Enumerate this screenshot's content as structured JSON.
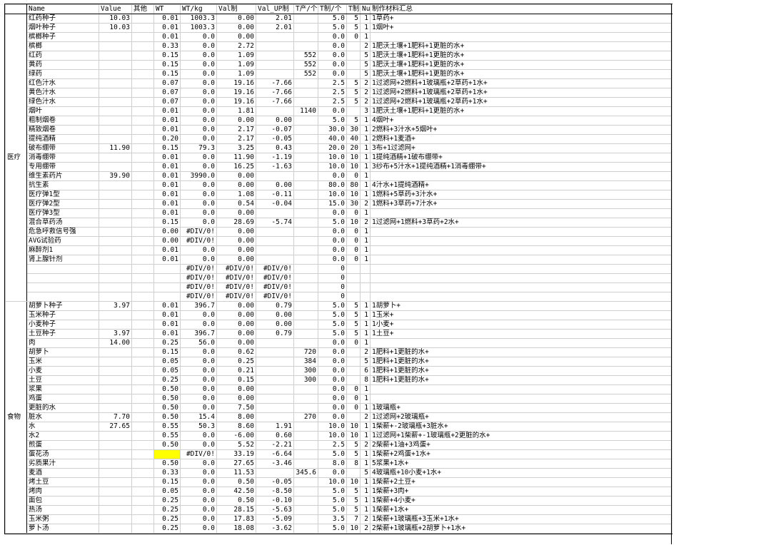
{
  "headers": [
    "",
    "Name",
    "Value",
    "其他",
    "WT",
    "WT/kg",
    "Val制",
    "Val_UP制",
    "T产/个",
    "T制/个",
    "T制",
    "Num",
    "制作材料汇总"
  ],
  "groups": [
    {
      "label": "医疗",
      "rows": [
        [
          "红药种子",
          "10.03",
          "",
          "0.01",
          "1003.3",
          "0.00",
          "2.01",
          "",
          "5.0",
          "5",
          "1",
          "1草药+"
        ],
        [
          "烟叶种子",
          "10.03",
          "",
          "0.01",
          "1003.3",
          "0.00",
          "2.01",
          "",
          "5.0",
          "5",
          "1",
          "1烟叶+"
        ],
        [
          "槟榔种子",
          "",
          "",
          "0.01",
          "0.0",
          "0.00",
          "",
          "",
          "0.0",
          "0",
          "1",
          ""
        ],
        [
          "槟榔",
          "",
          "",
          "0.33",
          "0.0",
          "2.72",
          "",
          "",
          "0.0",
          "",
          "2",
          "1肥沃土壤+1肥料+1更脏的水+"
        ],
        [
          "红药",
          "",
          "",
          "0.15",
          "0.0",
          "1.09",
          "",
          "552",
          "0.0",
          "",
          "5",
          "1肥沃土壤+1肥料+1更脏的水+"
        ],
        [
          "黄药",
          "",
          "",
          "0.15",
          "0.0",
          "1.09",
          "",
          "552",
          "0.0",
          "",
          "5",
          "1肥沃土壤+1肥料+1更脏的水+"
        ],
        [
          "绿药",
          "",
          "",
          "0.15",
          "0.0",
          "1.09",
          "",
          "552",
          "0.0",
          "",
          "5",
          "1肥沃土壤+1肥料+1更脏的水+"
        ],
        [
          "红色汁水",
          "",
          "",
          "0.07",
          "0.0",
          "19.16",
          "-7.66",
          "",
          "2.5",
          "5",
          "2",
          "1过滤网+2燃料+1玻璃瓶+2草药+1水+"
        ],
        [
          "黄色汁水",
          "",
          "",
          "0.07",
          "0.0",
          "19.16",
          "-7.66",
          "",
          "2.5",
          "5",
          "2",
          "1过滤网+2燃料+1玻璃瓶+2草药+1水+"
        ],
        [
          "绿色汁水",
          "",
          "",
          "0.07",
          "0.0",
          "19.16",
          "-7.66",
          "",
          "2.5",
          "5",
          "2",
          "1过滤网+2燃料+1玻璃瓶+2草药+1水+"
        ],
        [
          "烟叶",
          "",
          "",
          "0.01",
          "0.0",
          "1.81",
          "",
          "1140",
          "0.0",
          "",
          "3",
          "1肥沃土壤+1肥料+1更脏的水+"
        ],
        [
          "粗制烟卷",
          "",
          "",
          "0.01",
          "0.0",
          "0.00",
          "0.00",
          "",
          "5.0",
          "5",
          "1",
          "4烟叶+"
        ],
        [
          "精致烟卷",
          "",
          "",
          "0.01",
          "0.0",
          "2.17",
          "-0.07",
          "",
          "30.0",
          "30",
          "1",
          "2燃料+3汁水+5烟叶+"
        ],
        [
          "提纯酒精",
          "",
          "",
          "0.20",
          "0.0",
          "2.17",
          "-0.05",
          "",
          "40.0",
          "40",
          "1",
          "2燃料+1麦酒+"
        ],
        [
          "破布绷带",
          "11.90",
          "",
          "0.15",
          "79.3",
          "3.25",
          "0.43",
          "",
          "20.0",
          "20",
          "1",
          "3布+1过滤网+"
        ],
        [
          "消毒绷带",
          "",
          "",
          "0.01",
          "0.0",
          "11.90",
          "-1.19",
          "",
          "10.0",
          "10",
          "1",
          "1提纯酒精+1破布绷带+"
        ],
        [
          "专用绷带",
          "",
          "",
          "0.01",
          "0.0",
          "16.25",
          "-1.63",
          "",
          "10.0",
          "10",
          "1",
          "3纱布+5汁水+1提纯酒精+1消毒绷带+"
        ],
        [
          "维生素药片",
          "39.90",
          "",
          "0.01",
          "3990.0",
          "0.00",
          "",
          "",
          "0.0",
          "0",
          "1",
          ""
        ],
        [
          "抗生素",
          "",
          "",
          "0.01",
          "0.0",
          "0.00",
          "0.00",
          "",
          "80.0",
          "80",
          "1",
          "4汁水+1提纯酒精+"
        ],
        [
          "医疗弹1型",
          "",
          "",
          "0.01",
          "0.0",
          "1.08",
          "-0.11",
          "",
          "10.0",
          "10",
          "1",
          "1燃料+5草药+3汁水+"
        ],
        [
          "医疗弹2型",
          "",
          "",
          "0.01",
          "0.0",
          "0.54",
          "-0.04",
          "",
          "15.0",
          "30",
          "2",
          "1燃料+3草药+7汁水+"
        ],
        [
          "医疗弹3型",
          "",
          "",
          "0.01",
          "0.0",
          "0.00",
          "",
          "",
          "0.0",
          "0",
          "1",
          ""
        ],
        [
          "混合草药汤",
          "",
          "",
          "0.15",
          "0.0",
          "28.69",
          "-5.74",
          "",
          "5.0",
          "10",
          "2",
          "1过滤网+1燃料+3草药+2水+"
        ],
        [
          "危急呼救信号强",
          "",
          "",
          "0.00",
          "#DIV/0!",
          "0.00",
          "",
          "",
          "0.0",
          "0",
          "1",
          ""
        ],
        [
          "AVG试验药",
          "",
          "",
          "0.00",
          "#DIV/0!",
          "0.00",
          "",
          "",
          "0.0",
          "0",
          "1",
          ""
        ],
        [
          "麻醉剂1",
          "",
          "",
          "0.01",
          "0.0",
          "0.00",
          "",
          "",
          "0.0",
          "0",
          "1",
          ""
        ],
        [
          "肾上腺针剂",
          "",
          "",
          "0.01",
          "0.0",
          "0.00",
          "",
          "",
          "0.0",
          "0",
          "1",
          ""
        ],
        [
          "",
          "",
          "",
          "",
          "#DIV/0!",
          "#DIV/0!",
          "#DIV/0!",
          "",
          "0",
          "",
          "",
          ""
        ],
        [
          "",
          "",
          "",
          "",
          "#DIV/0!",
          "#DIV/0!",
          "#DIV/0!",
          "",
          "0",
          "",
          "",
          ""
        ],
        [
          "",
          "",
          "",
          "",
          "#DIV/0!",
          "#DIV/0!",
          "#DIV/0!",
          "",
          "0",
          "",
          "",
          ""
        ],
        [
          "",
          "",
          "",
          "",
          "#DIV/0!",
          "#DIV/0!",
          "#DIV/0!",
          "",
          "0",
          "",
          "",
          ""
        ]
      ]
    },
    {
      "label": "食物",
      "rows": [
        [
          "胡萝卜种子",
          "3.97",
          "",
          "0.01",
          "396.7",
          "0.00",
          "0.79",
          "",
          "5.0",
          "5",
          "1",
          "1胡萝卜+"
        ],
        [
          "玉米种子",
          "",
          "",
          "0.01",
          "0.0",
          "0.00",
          "0.00",
          "",
          "5.0",
          "5",
          "1",
          "1玉米+"
        ],
        [
          "小麦种子",
          "",
          "",
          "0.01",
          "0.0",
          "0.00",
          "0.00",
          "",
          "5.0",
          "5",
          "1",
          "1小麦+"
        ],
        [
          "土豆种子",
          "3.97",
          "",
          "0.01",
          "396.7",
          "0.00",
          "0.79",
          "",
          "5.0",
          "5",
          "1",
          "1土豆+"
        ],
        [
          "肉",
          "14.00",
          "",
          "0.25",
          "56.0",
          "0.00",
          "",
          "",
          "0.0",
          "0",
          "1",
          ""
        ],
        [
          "胡萝卜",
          "",
          "",
          "0.15",
          "0.0",
          "0.62",
          "",
          "720",
          "0.0",
          "",
          "2",
          "1肥料+1更脏的水+"
        ],
        [
          "玉米",
          "",
          "",
          "0.05",
          "0.0",
          "0.25",
          "",
          "384",
          "0.0",
          "",
          "5",
          "1肥料+1更脏的水+"
        ],
        [
          "小麦",
          "",
          "",
          "0.05",
          "0.0",
          "0.21",
          "",
          "300",
          "0.0",
          "",
          "6",
          "1肥料+1更脏的水+"
        ],
        [
          "土豆",
          "",
          "",
          "0.25",
          "0.0",
          "0.15",
          "",
          "300",
          "0.0",
          "",
          "8",
          "1肥料+1更脏的水+"
        ],
        [
          "浆果",
          "",
          "",
          "0.50",
          "0.0",
          "0.00",
          "",
          "",
          "0.0",
          "0",
          "1",
          ""
        ],
        [
          "鸡蛋",
          "",
          "",
          "0.50",
          "0.0",
          "0.00",
          "",
          "",
          "0.0",
          "0",
          "1",
          ""
        ],
        [
          "更脏的水",
          "",
          "",
          "0.50",
          "0.0",
          "7.50",
          "",
          "",
          "0.0",
          "0",
          "1",
          "1玻璃瓶+"
        ],
        [
          "脏水",
          "7.70",
          "",
          "0.50",
          "15.4",
          "8.00",
          "",
          "270",
          "0.0",
          "",
          "2",
          "1过滤网+2玻璃瓶+"
        ],
        [
          "水",
          "27.65",
          "",
          "0.55",
          "50.3",
          "8.60",
          "1.91",
          "",
          "10.0",
          "10",
          "1",
          "1柴薪+-2玻璃瓶+3脏水+"
        ],
        [
          "水2",
          "",
          "",
          "0.55",
          "0.0",
          "-6.00",
          "0.60",
          "",
          "10.0",
          "10",
          "1",
          "1过滤网+1柴薪+-1玻璃瓶+2更脏的水+"
        ],
        [
          "煎蛋",
          "",
          "",
          "0.50",
          "0.0",
          "5.52",
          "-2.21",
          "",
          "2.5",
          "5",
          "2",
          "2柴薪+1油+3鸡蛋+"
        ],
        [
          "蛋花汤",
          "",
          "",
          "",
          "#DIV/0!",
          "33.19",
          "-6.64",
          "",
          "5.0",
          "5",
          "1",
          "1柴薪+2鸡蛋+1水+"
        ],
        [
          "劣质果汁",
          "",
          "",
          "0.50",
          "0.0",
          "27.65",
          "-3.46",
          "",
          "8.0",
          "8",
          "1",
          "5浆果+1水+"
        ],
        [
          "麦酒",
          "",
          "",
          "0.33",
          "0.0",
          "11.53",
          "",
          "345.6",
          "0.0",
          "",
          "5",
          "4玻璃瓶+10小麦+1水+"
        ],
        [
          "烤土豆",
          "",
          "",
          "0.15",
          "0.0",
          "0.50",
          "-0.05",
          "",
          "10.0",
          "10",
          "1",
          "1柴薪+2土豆+"
        ],
        [
          "烤肉",
          "",
          "",
          "0.05",
          "0.0",
          "42.50",
          "-8.50",
          "",
          "5.0",
          "5",
          "1",
          "1柴薪+3肉+"
        ],
        [
          "面包",
          "",
          "",
          "0.25",
          "0.0",
          "0.50",
          "-0.10",
          "",
          "5.0",
          "5",
          "1",
          "1柴薪+4小麦+"
        ],
        [
          "热汤",
          "",
          "",
          "0.25",
          "0.0",
          "28.15",
          "-5.63",
          "",
          "5.0",
          "5",
          "1",
          "1柴薪+1水+"
        ],
        [
          "玉米粥",
          "",
          "",
          "0.25",
          "0.0",
          "17.83",
          "-5.09",
          "",
          "3.5",
          "7",
          "2",
          "1柴薪+1玻璃瓶+3玉米+1水+"
        ],
        [
          "萝卜汤",
          "",
          "",
          "0.25",
          "0.0",
          "18.08",
          "-3.62",
          "",
          "5.0",
          "10",
          "2",
          "2柴薪+1玻璃瓶+2胡萝卜+1水+"
        ]
      ]
    }
  ],
  "highlight": {
    "color": "#ffff00",
    "group": 1,
    "row": 16,
    "col": 3
  },
  "colors": {
    "grid": "#cfcfcf",
    "border": "#000000"
  }
}
